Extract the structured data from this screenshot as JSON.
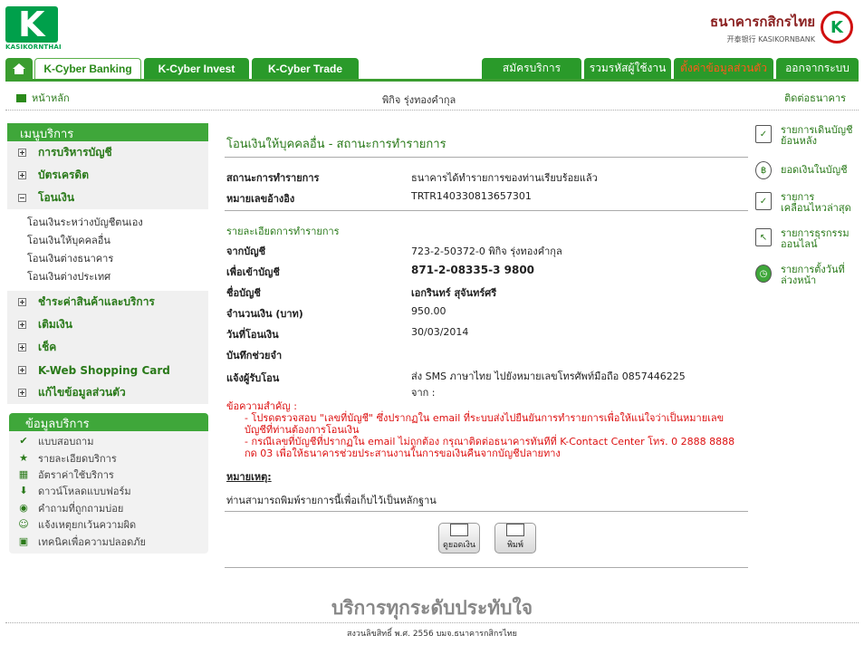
{
  "header": {
    "logo_text": "KASIKORNTHAI",
    "bank_name_th": "ธนาคารกสิกรไทย",
    "bank_name_en": "开泰银行 KASIKORNBANK"
  },
  "tabs": {
    "home_icon": "home-icon",
    "left": [
      "K-Cyber Banking",
      "K-Cyber Invest",
      "K-Cyber Trade"
    ],
    "right": [
      "สมัครบริการ",
      "รวมรหัสผู้ใช้งาน",
      "ตั้งค่าข้อมูลส่วนตัว",
      "ออกจากระบบ"
    ]
  },
  "subbar": {
    "home_label": "หน้าหลัก",
    "user_name": "พิกิจ รุ่งทองคำกุล",
    "contact_label": "ติดต่อธนาคาร"
  },
  "menu": {
    "title": "เมนูบริการ",
    "items": [
      {
        "label": "การบริหารบัญชี"
      },
      {
        "label": "บัตรเครดิต"
      },
      {
        "label": "โอนเงิน"
      },
      {
        "label": "ชำระค่าสินค้าและบริการ"
      },
      {
        "label": "เติมเงิน"
      },
      {
        "label": "เช็ค"
      },
      {
        "label": "K-Web Shopping Card"
      },
      {
        "label": "แก้ไขข้อมูลส่วนตัว"
      }
    ],
    "transfer_sub": [
      "โอนเงินระหว่างบัญชีตนเอง",
      "โอนเงินให้บุคคลอื่น",
      "โอนเงินต่างธนาคาร",
      "โอนเงินต่างประเทศ"
    ]
  },
  "info": {
    "title": "ข้อมูลบริการ",
    "items": [
      {
        "label": "แบบสอบถาม",
        "icon": "checkmark-icon",
        "glyph": "✔"
      },
      {
        "label": "รายละเอียดบริการ",
        "icon": "star-icon",
        "glyph": "★"
      },
      {
        "label": "อัตราค่าใช้บริการ",
        "icon": "table-icon",
        "glyph": "▦"
      },
      {
        "label": "ดาวน์โหลดแบบฟอร์ม",
        "icon": "download-icon",
        "glyph": "⬇"
      },
      {
        "label": "คำถามที่ถูกถามบ่อย",
        "icon": "question-icon",
        "glyph": "◉"
      },
      {
        "label": "แจ้งเหตุยกเว้นความผิด",
        "icon": "people-icon",
        "glyph": "☺"
      },
      {
        "label": "เทคนิคเพื่อความปลอดภัย",
        "icon": "lock-icon",
        "glyph": "▣"
      }
    ]
  },
  "main": {
    "title": "โอนเงินให้บุคคลอื่น - สถานะการทำรายการ",
    "status_label": "สถานะการทำรายการ",
    "status_value": "ธนาคารได้ทำรายการของท่านเรียบร้อยแล้ว",
    "ref_label": "หมายเลขอ้างอิง",
    "ref_value": "TRTR140330813657301",
    "detail_header": "รายละเอียดการทำรายการ",
    "from_label": "จากบัญชี",
    "from_value": "723-2-50372-0 พิกิจ รุ่งทองคำกุล",
    "to_label": "เพื่อเข้าบัญชี",
    "to_value": "871-2-08335-3 9800",
    "acct_name_label": "ชื่อบัญชี",
    "acct_name_value": "เอกรินทร์ สุจันทร์ศรี",
    "amount_label": "จำนวนเงิน (บาท)",
    "amount_value": "950.00",
    "date_label": "วันที่โอนเงิน",
    "date_value": "30/03/2014",
    "memo_label": "บันทึกช่วยจำ",
    "memo_value": "",
    "notify_label": "แจ้งผู้รับโอน",
    "notify_value_1": "ส่ง SMS ภาษาไทย ไปยังหมายเลขโทรศัพท์มือถือ 0857446225",
    "notify_value_2": "จาก :",
    "notes_title": "ข้อความสำคัญ :",
    "note_1": "- โปรดตรวจสอบ \"เลขที่บัญชี\" ซึ่งปรากฏใน email ที่ระบบส่งไปยืนยันการทำรายการเพื่อให้แน่ใจว่าเป็นหมายเลขบัญชีที่ท่านต้องการโอนเงิน",
    "note_2": "- กรณีเลขที่บัญชีที่ปรากฏใน email ไม่ถูกต้อง กรุณาติดต่อธนาคารทันทีที่ K-Contact Center โทร. 0 2888 8888 กด 03 เพื่อให้ธนาคารช่วยประสานงานในการขอเงินคืนจากบัญชีปลายทาง",
    "remark_title": "หมายเหตุ:",
    "remark_text": "ท่านสามารถพิมพ์รายการนี้เพื่อเก็บไว้เป็นหลักฐาน",
    "btn_view": "ดูยอดเงิน",
    "btn_print": "พิมพ์"
  },
  "side": {
    "items": [
      {
        "label": "รายการเดินบัญชีย้อนหลัง",
        "icon": "statement-icon",
        "glyph": "✓"
      },
      {
        "label": "ยอดเงินในบัญชี",
        "icon": "money-bag-icon",
        "glyph": "฿"
      },
      {
        "label": "รายการเคลื่อนไหวล่าสุด",
        "icon": "recent-icon",
        "glyph": "✓"
      },
      {
        "label": "รายการธุรกรรมออนไลน์",
        "icon": "monitor-icon",
        "glyph": "↖"
      },
      {
        "label": "รายการตั้งวันที่ล่วงหน้า",
        "icon": "clock-icon",
        "glyph": "◷"
      }
    ]
  },
  "footer": {
    "slogan": "บริการทุกระดับประทับใจ",
    "copyright": "สงวนลิขสิทธิ์ พ.ศ. 2556 บมจ.ธนาคารกสิกรไทย"
  },
  "colors": {
    "brand_green": "#3fa73a",
    "link_green": "#2a7a1a",
    "alert_red": "#dd1111"
  }
}
